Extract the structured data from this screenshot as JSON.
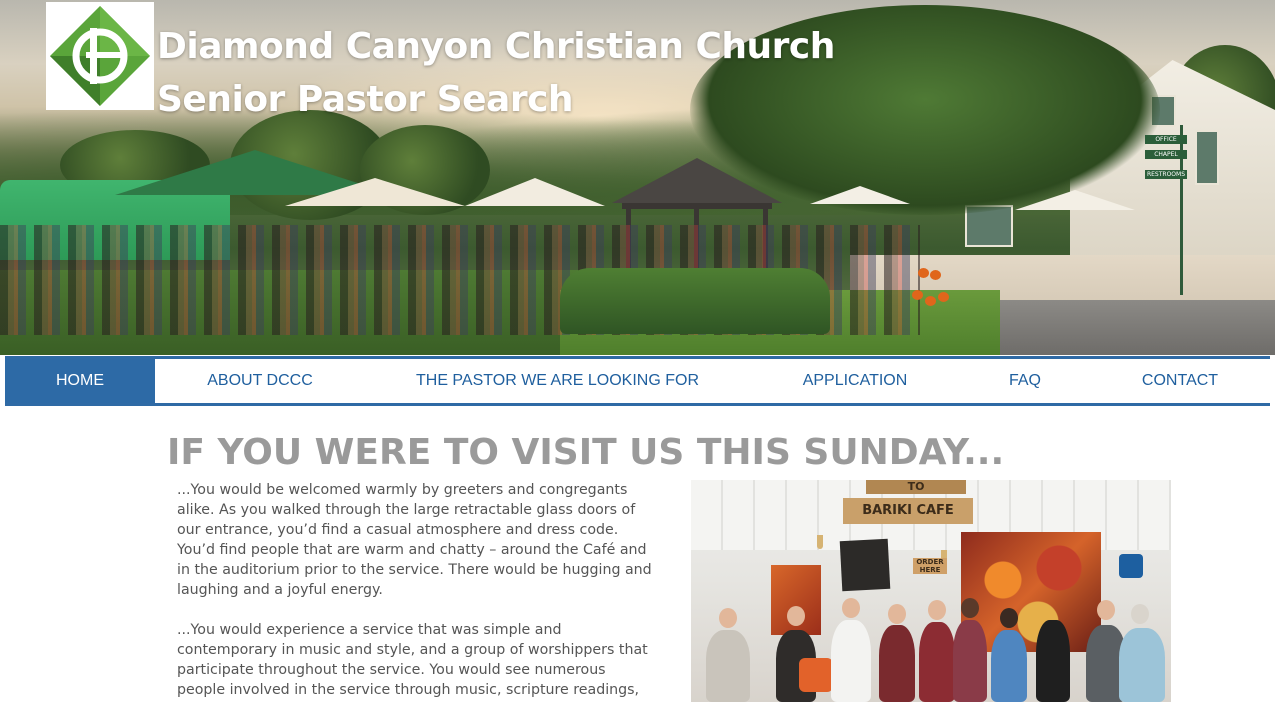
{
  "header": {
    "title_line1": "Diamond Canyon Christian Church",
    "title_line2": "Senior Pastor Search",
    "logo_colors": {
      "green": "#5aa53a",
      "dark_green": "#3f7f2a",
      "white": "#ffffff"
    }
  },
  "nav": {
    "items": [
      {
        "label": "HOME",
        "active": true
      },
      {
        "label": "ABOUT DCCC",
        "active": false
      },
      {
        "label": "THE PASTOR WE ARE LOOKING FOR",
        "active": false
      },
      {
        "label": "APPLICATION",
        "active": false
      },
      {
        "label": "FAQ",
        "active": false
      },
      {
        "label": "CONTACT",
        "active": false
      }
    ],
    "accent_color": "#2d6aa6"
  },
  "main": {
    "heading": "IF YOU WERE TO VISIT US THIS SUNDAY...",
    "paragraph1_lines": [
      "...You would be welcomed warmly by greeters and congregants",
      "alike. As you walked through the large retractable glass doors of",
      "our entrance, you’d find a casual atmosphere and dress code.",
      "You’d find people that are warm and chatty – around the Café and",
      "in the auditorium prior to the service. There would be hugging and",
      "laughing and a joyful energy."
    ],
    "paragraph2_lines": [
      "...You would experience a service that was simple and",
      "contemporary in music and style, and a group of worshippers that",
      "participate throughout the service. You would see numerous",
      "people involved in the service through music, scripture readings,"
    ],
    "photo": {
      "sign_text": "BARIKI CAFE",
      "sign_top_text": "TO",
      "order_sign_text": "ORDER HERE"
    }
  },
  "hero_signpost": {
    "labels": [
      "OFFICE",
      "CHAPEL",
      "RESTROOMS"
    ]
  }
}
